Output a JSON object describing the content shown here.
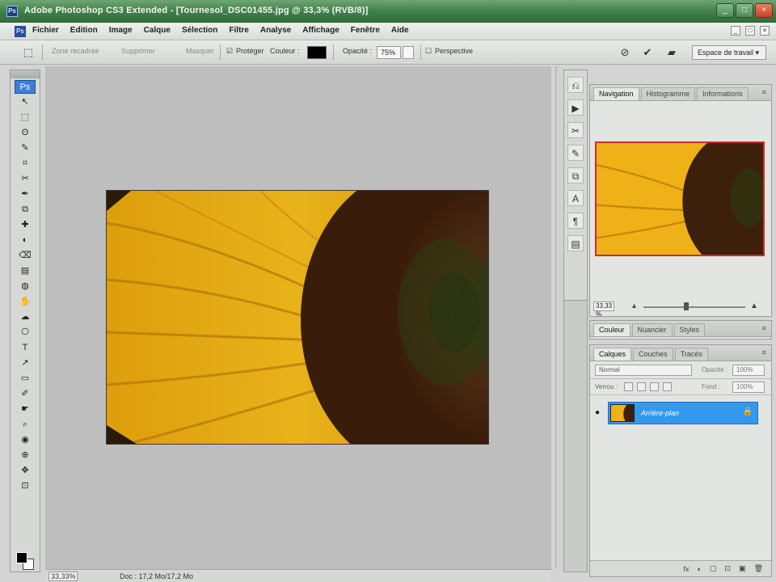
{
  "window": {
    "title": "Adobe Photoshop CS3 Extended - [Tournesol_DSC01455.jpg @ 33,3% (RVB/8)]",
    "controls": [
      "_",
      "□",
      "×"
    ]
  },
  "menubar": {
    "logo": "Ps",
    "items": [
      "Fichier",
      "Edition",
      "Image",
      "Calque",
      "Sélection",
      "Filtre",
      "Analyse",
      "Affichage",
      "Fenêtre",
      "Aide"
    ]
  },
  "options": {
    "tool_icon": "⬚",
    "crop_label": "Zone recadrée",
    "delete_label": "Supprimer",
    "mask_label": "Masquer",
    "shield_label": "Protéger",
    "color_label": "Couleur :",
    "opacity_label": "Opacité :",
    "opacity_value": "75%",
    "perspective_label": "Perspective",
    "workspace": "Espace de travail ▾",
    "shield_color": "#000000"
  },
  "tools": {
    "active": "Ps",
    "glyphs": [
      "↖",
      "⬚",
      "ʘ",
      "✎",
      "⌗",
      "✂",
      "✒",
      "⧉",
      "✚",
      "◐",
      "⌫",
      "▤",
      "◍",
      "✋",
      "☁",
      "⎔",
      "T",
      "↗",
      "▭",
      "✐",
      "☛",
      "⌕",
      "◉",
      "⊕",
      "✥",
      "⊡",
      "▣",
      "⌖",
      "✋",
      "🔍"
    ]
  },
  "canvas": {
    "zoom": "33,33%",
    "doc_info": "Doc : 17,2 Mo/17,2 Mo"
  },
  "navigator": {
    "tabs": [
      "Navigation",
      "Histogramme",
      "Informations"
    ],
    "zoom_value": "33,33 %"
  },
  "color_panel": {
    "tabs": [
      "Couleur",
      "Nuancier",
      "Styles"
    ]
  },
  "layers": {
    "tabs": [
      "Calques",
      "Couches",
      "Tracés"
    ],
    "blend_mode": "Normal",
    "opacity_label": "Opacité :",
    "opacity_value": "100%",
    "lock_label": "Verrou :",
    "fill_label": "Fond :",
    "fill_value": "100%",
    "layer_name": "Arrière-plan",
    "footer_icons": [
      "fx",
      "◐",
      "▢",
      "⊡",
      "▣",
      "🗑"
    ]
  }
}
